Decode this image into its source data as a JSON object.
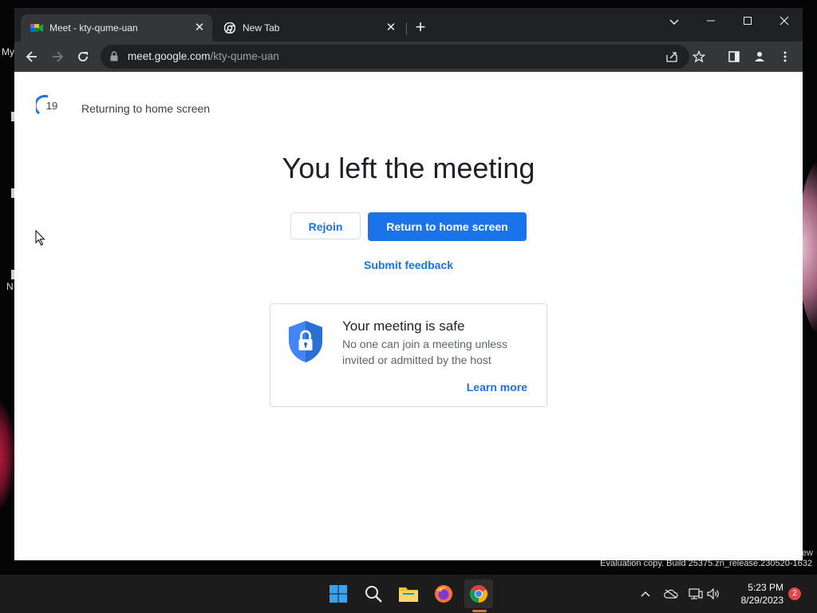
{
  "browser": {
    "tabs": [
      {
        "title": "Meet - kty-qume-uan",
        "favicon": "google-meet-icon",
        "active": true
      },
      {
        "title": "New Tab",
        "favicon": "chrome-icon",
        "active": false
      }
    ],
    "address": {
      "host": "meet.google.com",
      "path": "/kty-qume-uan"
    }
  },
  "page": {
    "countdown": "19",
    "returning_text": "Returning to home screen",
    "headline": "You left the meeting",
    "rejoin_label": "Rejoin",
    "return_label": "Return to home screen",
    "feedback_label": "Submit feedback",
    "safe_card": {
      "title": "Your meeting is safe",
      "description": "No one can join a meeting unless invited or admitted by the host",
      "learn_more": "Learn more"
    }
  },
  "desktop": {
    "labels": [
      "My",
      "N"
    ],
    "watermark_tail": "ew",
    "watermark": "Evaluation copy. Build 25375.zn_release.230520-1632"
  },
  "taskbar": {
    "apps": [
      "windows-start-icon",
      "search-icon",
      "file-explorer-icon",
      "firefox-icon",
      "chrome-icon"
    ],
    "time": "5:23 PM",
    "date": "8/29/2023",
    "notification_count": "2"
  },
  "colors": {
    "accent": "#1a73e8",
    "chrome_dark": "#202124",
    "toolbar": "#35363a"
  }
}
